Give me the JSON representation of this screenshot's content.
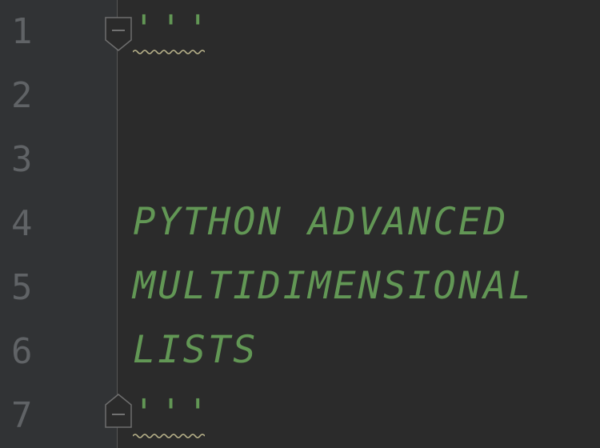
{
  "editor": {
    "line_numbers": [
      "1",
      "2",
      "3",
      "4",
      "5",
      "6",
      "7"
    ],
    "lines": {
      "l1": "'''",
      "l2": "",
      "l3": "",
      "l4": "PYTHON ADVANCED",
      "l5": "MULTIDIMENSIONAL",
      "l6": "LISTS",
      "l7": "'''"
    }
  },
  "colors": {
    "background": "#2b2b2b",
    "gutter": "#313335",
    "line_number": "#606366",
    "docstring": "#629755",
    "fold_marker": "#6e6e6e",
    "squiggle": "#b8b28a"
  },
  "icons": {
    "fold_start": "fold-collapse-icon",
    "fold_end": "fold-end-icon"
  }
}
